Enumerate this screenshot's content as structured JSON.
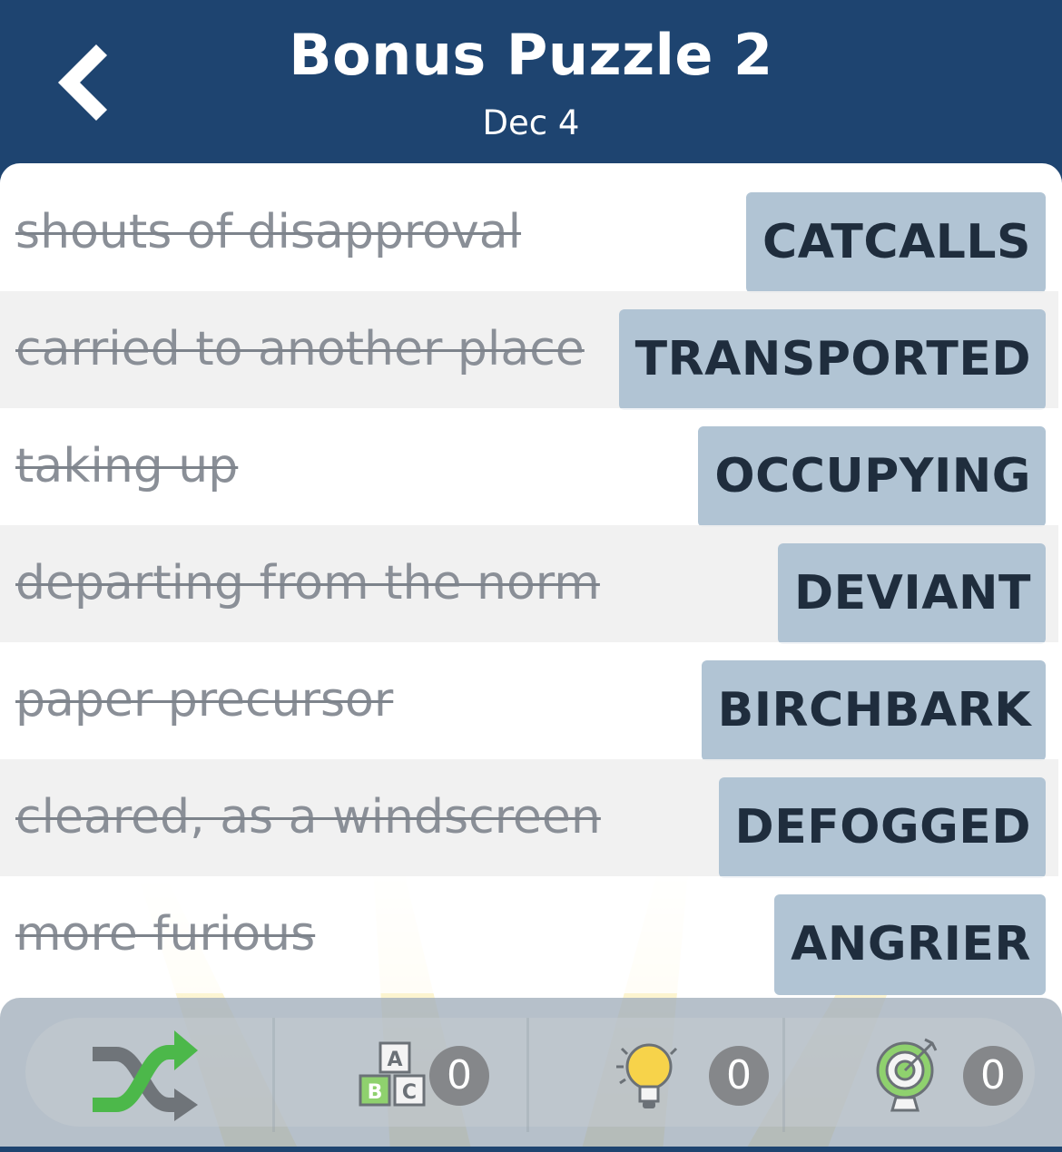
{
  "header": {
    "title": "Bonus Puzzle 2",
    "date": "Dec 4"
  },
  "clues": [
    {
      "clue": "shouts of disapproval",
      "answer": "CATCALLS",
      "solved": true
    },
    {
      "clue": "carried to another place",
      "answer": "TRANSPORTED",
      "solved": true
    },
    {
      "clue": "taking up",
      "answer": "OCCUPYING",
      "solved": true
    },
    {
      "clue": "departing from the norm",
      "answer": "DEVIANT",
      "solved": true
    },
    {
      "clue": "paper precursor",
      "answer": "BIRCHBARK",
      "solved": true
    },
    {
      "clue": "cleared, as a windscreen",
      "answer": "DEFOGGED",
      "solved": true
    },
    {
      "clue": "more furious",
      "answer": "ANGRIER",
      "solved": true
    }
  ],
  "toolbar": {
    "shuffle_icon": "shuffle-icon",
    "letters_count": "0",
    "hint_count": "0",
    "target_count": "0"
  },
  "colors": {
    "header_bg": "#1e4470",
    "answer_bg": "#b1c4d4",
    "answer_text": "#1f2d3d",
    "clue_text": "#8a8f97",
    "shuffle_green": "#4cb84a",
    "shuffle_gray": "#6f7479",
    "badge_bg": "#85878a"
  }
}
